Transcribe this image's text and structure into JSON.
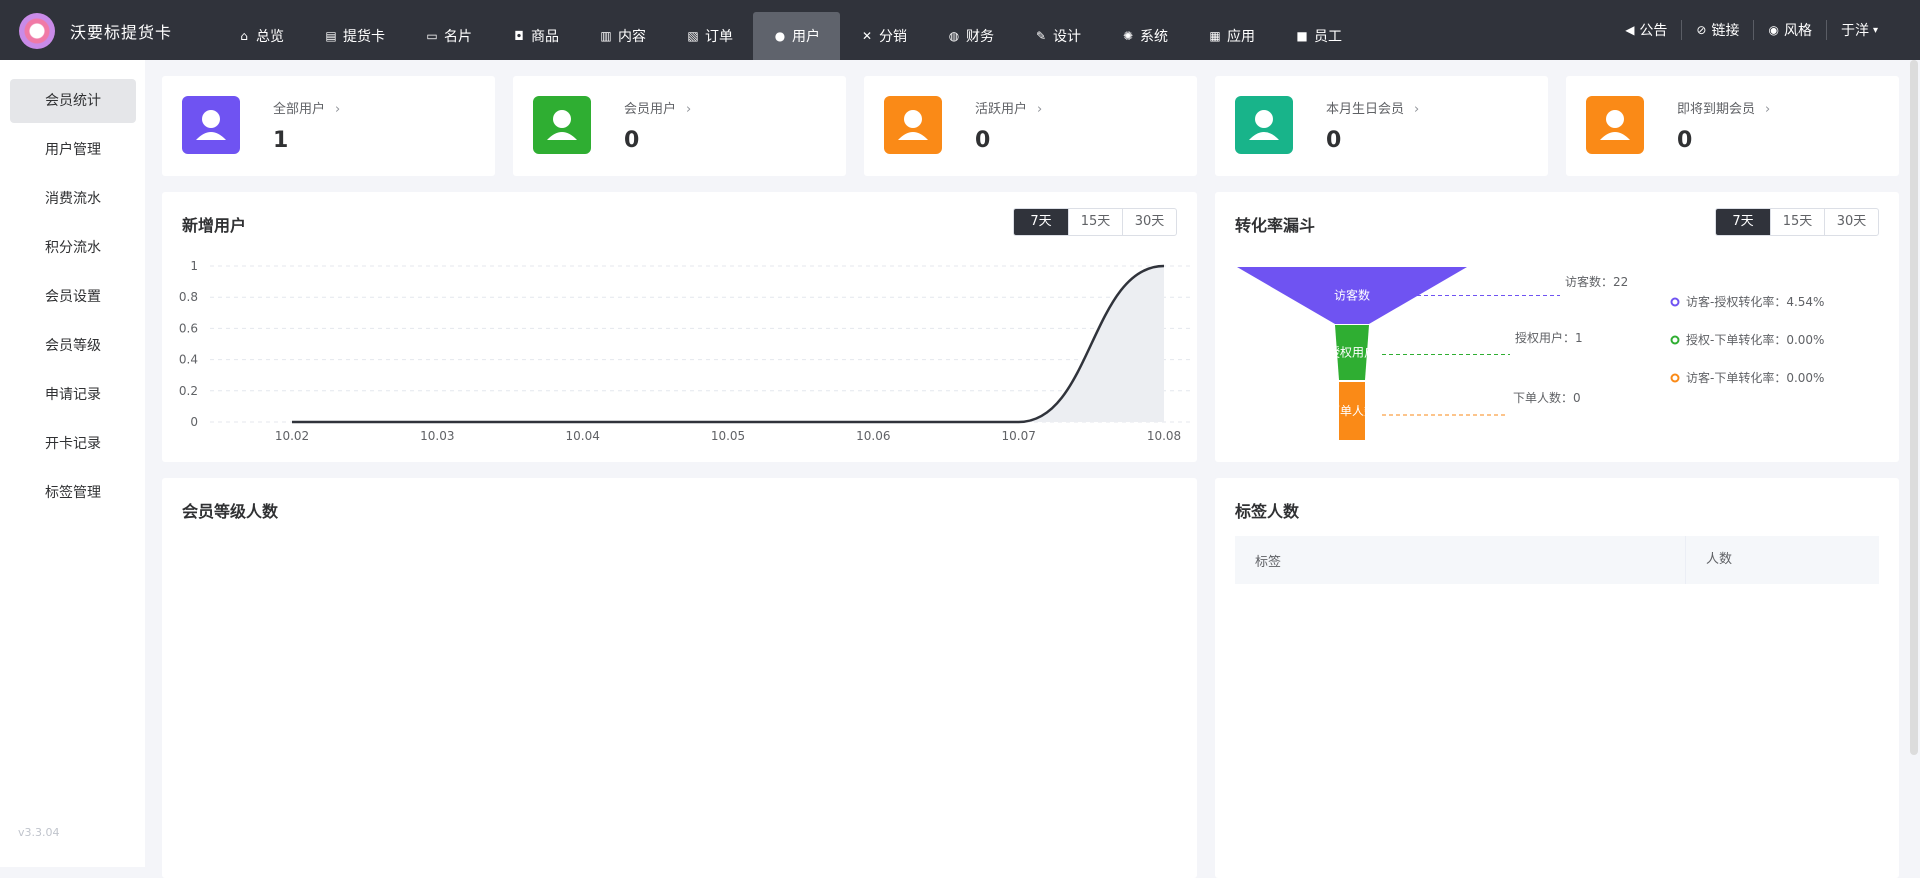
{
  "app": {
    "title": "沃要标提货卡",
    "version": "v3.3.04"
  },
  "nav": [
    {
      "label": "总览",
      "icon": "home-icon",
      "glyph": "⌂"
    },
    {
      "label": "提货卡",
      "icon": "card-icon",
      "glyph": "▤"
    },
    {
      "label": "名片",
      "icon": "id-card-icon",
      "glyph": "▭"
    },
    {
      "label": "商品",
      "icon": "bag-icon",
      "glyph": "◘"
    },
    {
      "label": "内容",
      "icon": "document-icon",
      "glyph": "▥"
    },
    {
      "label": "订单",
      "icon": "clipboard-icon",
      "glyph": "▧"
    },
    {
      "label": "用户",
      "icon": "user-icon",
      "glyph": "●",
      "active": true
    },
    {
      "label": "分销",
      "icon": "network-icon",
      "glyph": "✕"
    },
    {
      "label": "财务",
      "icon": "money-bag-icon",
      "glyph": "◍"
    },
    {
      "label": "设计",
      "icon": "brush-icon",
      "glyph": "✎"
    },
    {
      "label": "系统",
      "icon": "gear-icon",
      "glyph": "✺"
    },
    {
      "label": "应用",
      "icon": "apps-icon",
      "glyph": "▦"
    },
    {
      "label": "员工",
      "icon": "lock-icon",
      "glyph": "■"
    }
  ],
  "right_nav": {
    "announce": "公告",
    "link": "链接",
    "style": "风格",
    "user": "于洋"
  },
  "sidebar": [
    {
      "label": "会员统计",
      "active": true
    },
    {
      "label": "用户管理"
    },
    {
      "label": "消费流水"
    },
    {
      "label": "积分流水"
    },
    {
      "label": "会员设置"
    },
    {
      "label": "会员等级"
    },
    {
      "label": "申请记录"
    },
    {
      "label": "开卡记录"
    },
    {
      "label": "标签管理"
    }
  ],
  "stats": [
    {
      "label": "全部用户",
      "value": "1",
      "color": "#6f53f2",
      "icon": "user-list-icon"
    },
    {
      "label": "会员用户",
      "value": "0",
      "color": "#2fae32",
      "icon": "vip-user-icon"
    },
    {
      "label": "活跃用户",
      "value": "0",
      "color": "#fa8a17",
      "icon": "megaphone-icon"
    },
    {
      "label": "本月生日会员",
      "value": "0",
      "color": "#18b48a",
      "icon": "cake-icon"
    },
    {
      "label": "即将到期会员",
      "value": "0",
      "color": "#fa8a17",
      "icon": "alarm-clock-icon"
    }
  ],
  "new_users": {
    "title": "新增用户",
    "ranges": [
      "7天",
      "15天",
      "30天"
    ],
    "active_range": "7天"
  },
  "funnel": {
    "title": "转化率漏斗",
    "ranges": [
      "7天",
      "15天",
      "30天"
    ],
    "active_range": "7天",
    "stages": [
      {
        "label": "访客数",
        "value": 22,
        "callout": "访客数：22",
        "color": "#6f53f2",
        "display": "访客数"
      },
      {
        "label": "授权用户",
        "value": 1,
        "callout": "授权用户：1",
        "color": "#2fae32",
        "display": "授权用户"
      },
      {
        "label": "下单人数",
        "value": 0,
        "callout": "下单人数：0",
        "color": "#fa8a17",
        "display": "下单人数"
      }
    ],
    "legend": [
      {
        "text": "访客-授权转化率：4.54%",
        "color": "#6f53f2"
      },
      {
        "text": "授权-下单转化率：0.00%",
        "color": "#2fae32"
      },
      {
        "text": "访客-下单转化率：0.00%",
        "color": "#fa8a17"
      }
    ]
  },
  "member_level": {
    "title": "会员等级人数"
  },
  "tags": {
    "title": "标签人数",
    "col_tag": "标签",
    "col_count": "人数"
  },
  "chart_data": {
    "type": "area",
    "x": [
      "10.02",
      "10.03",
      "10.04",
      "10.05",
      "10.06",
      "10.07",
      "10.08"
    ],
    "series": [
      {
        "values": [
          0,
          0,
          0,
          0,
          0,
          0,
          1
        ]
      }
    ],
    "ylim": [
      0,
      1
    ],
    "yticks": [
      "0",
      "0.2",
      "0.4",
      "0.6",
      "0.8",
      "1"
    ],
    "grid": true,
    "line_color": "#30333b"
  }
}
